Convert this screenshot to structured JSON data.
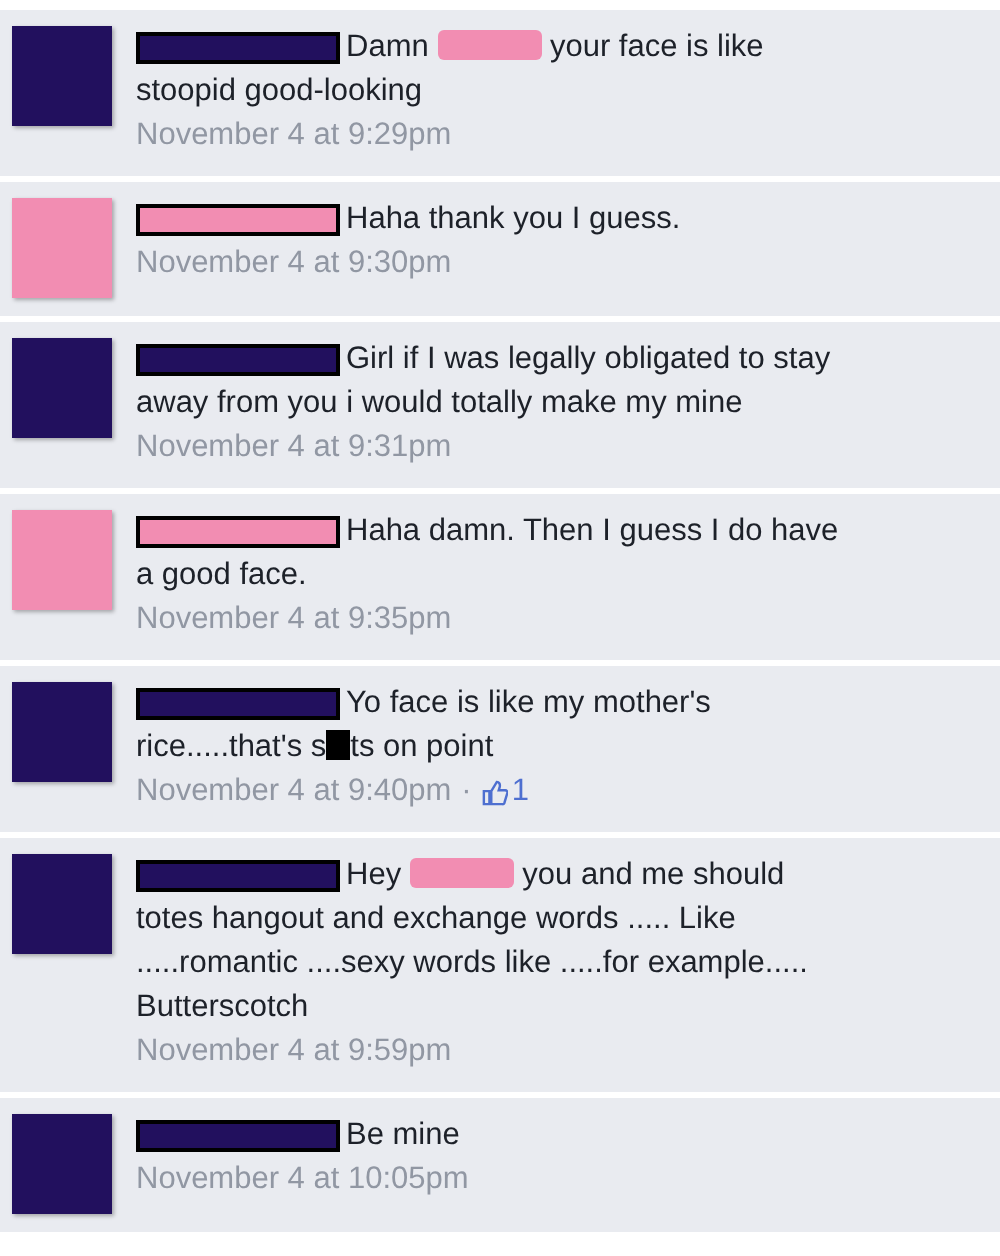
{
  "comments": [
    {
      "color": "#22105e",
      "lines": [
        {
          "parts": [
            {
              "kind": "text",
              "text": "Damn "
            },
            {
              "kind": "word"
            },
            {
              "kind": "text",
              "text": " your face is like"
            }
          ]
        },
        {
          "parts": [
            {
              "kind": "text",
              "text": "stoopid good-looking"
            }
          ]
        }
      ],
      "time": "November 4 at 9:29pm"
    },
    {
      "color": "#f28db2",
      "lines": [
        {
          "parts": [
            {
              "kind": "text",
              "text": "Haha thank you I guess."
            }
          ]
        }
      ],
      "time": "November 4 at 9:30pm"
    },
    {
      "color": "#22105e",
      "lines": [
        {
          "parts": [
            {
              "kind": "text",
              "text": "Girl if I was legally obligated to stay"
            }
          ]
        },
        {
          "parts": [
            {
              "kind": "text",
              "text": "away from you i would totally make my mine"
            }
          ]
        }
      ],
      "time": "November 4 at 9:31pm"
    },
    {
      "color": "#f28db2",
      "lines": [
        {
          "parts": [
            {
              "kind": "text",
              "text": "Haha damn. Then I guess I do have"
            }
          ]
        },
        {
          "parts": [
            {
              "kind": "text",
              "text": "a good face."
            }
          ]
        }
      ],
      "time": "November 4 at 9:35pm"
    },
    {
      "color": "#22105e",
      "lines": [
        {
          "parts": [
            {
              "kind": "text",
              "text": "Yo face is like my mother's"
            }
          ]
        },
        {
          "parts": [
            {
              "kind": "text",
              "text": "rice.....that's s"
            },
            {
              "kind": "letters"
            },
            {
              "kind": "text",
              "text": "ts on point"
            }
          ]
        }
      ],
      "time": "November 4 at 9:40pm",
      "separator": "·",
      "likes": "1"
    },
    {
      "color": "#22105e",
      "lines": [
        {
          "parts": [
            {
              "kind": "text",
              "text": "Hey "
            },
            {
              "kind": "word"
            },
            {
              "kind": "text",
              "text": " you and me should"
            }
          ]
        },
        {
          "parts": [
            {
              "kind": "text",
              "text": "totes hangout and exchange words ..... Like"
            }
          ]
        },
        {
          "parts": [
            {
              "kind": "text",
              "text": ".....romantic ....sexy words like .....for example....."
            }
          ]
        },
        {
          "parts": [
            {
              "kind": "text",
              "text": "Butterscotch"
            }
          ]
        }
      ],
      "time": "November 4 at 9:59pm"
    },
    {
      "color": "#22105e",
      "lines": [
        {
          "parts": [
            {
              "kind": "text",
              "text": "Be mine"
            }
          ]
        }
      ],
      "time": "November 4 at 10:05pm"
    }
  ]
}
